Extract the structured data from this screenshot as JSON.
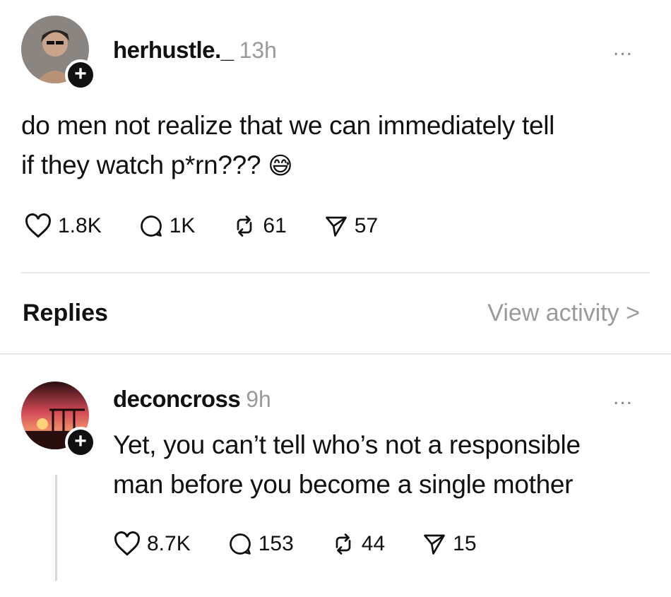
{
  "post": {
    "username": "herhustle._",
    "time": "13h",
    "more": "...",
    "text_line1": "do men not realize that we can immediately tell",
    "text_line2": "if they watch p*rn???",
    "emoji": "😅",
    "likes": "1.8K",
    "comments": "1K",
    "reposts": "61",
    "shares": "57"
  },
  "replies_header": {
    "label": "Replies",
    "view_activity": "View activity >"
  },
  "reply": {
    "username": "deconcross",
    "time": "9h",
    "more": "...",
    "text_line1": "Yet, you can’t tell who’s not a responsible",
    "text_line2": "man before you become a single mother",
    "likes": "8.7K",
    "comments": "153",
    "reposts": "44",
    "shares": "15"
  },
  "icons": {
    "like": "heart-icon",
    "comment": "comment-bubble-icon",
    "repost": "repost-icon",
    "share": "send-icon",
    "follow": "plus-icon",
    "more": "more-dots-icon"
  },
  "colors": {
    "text": "#111111",
    "muted": "#9a9a9a",
    "divider": "#e8e8e8"
  }
}
